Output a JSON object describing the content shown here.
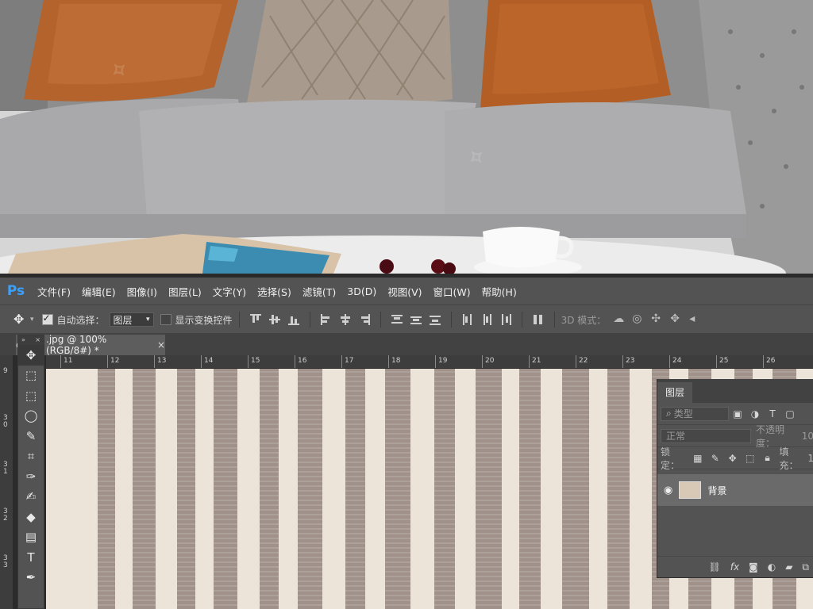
{
  "app": {
    "logo": "Ps"
  },
  "menu": [
    "文件(F)",
    "编辑(E)",
    "图像(I)",
    "图层(L)",
    "文字(Y)",
    "选择(S)",
    "滤镜(T)",
    "3D(D)",
    "视图(V)",
    "窗口(W)",
    "帮助(H)"
  ],
  "options": {
    "auto_select_label": "自动选择：",
    "auto_select_checked": true,
    "target_value": "图层",
    "show_transform_label": "显示变换控件",
    "show_transform_checked": false,
    "mode_3d_label": "3D 模式："
  },
  "document": {
    "tab_title": ".jpg @ 100%(RGB/8#) *",
    "tab_prefix": "c",
    "close_label": "×"
  },
  "ruler": {
    "h_ticks": [
      "11",
      "12",
      "13",
      "14",
      "15",
      "16",
      "17",
      "18",
      "19",
      "20",
      "21",
      "22",
      "23",
      "24",
      "25",
      "26"
    ],
    "v_ticks": [
      "9",
      "30",
      "31",
      "32",
      "33"
    ]
  },
  "tools": [
    {
      "name": "move-tool",
      "glyph": "✥"
    },
    {
      "name": "artboard-tool",
      "glyph": "⬚"
    },
    {
      "name": "marquee-tool",
      "glyph": "⬚"
    },
    {
      "name": "lasso-tool",
      "glyph": "◯"
    },
    {
      "name": "quick-select-tool",
      "glyph": "✎"
    },
    {
      "name": "crop-tool",
      "glyph": "⌗"
    },
    {
      "name": "eyedropper-tool",
      "glyph": "✑"
    },
    {
      "name": "brush-tool",
      "glyph": "✍"
    },
    {
      "name": "eraser-tool",
      "glyph": "◆"
    },
    {
      "name": "gradient-tool",
      "glyph": "▤"
    },
    {
      "name": "type-tool",
      "glyph": "T"
    },
    {
      "name": "pen-tool",
      "glyph": "✒"
    }
  ],
  "layers_panel": {
    "tab": "图层",
    "filter_kind": "类型",
    "blend_mode": "正常",
    "opacity_label": "不透明度：",
    "opacity_value": "10",
    "lock_label": "锁定：",
    "fill_label": "填充：",
    "fill_value": "1",
    "layers": [
      {
        "name": "背景",
        "visible": true
      }
    ],
    "footer_icons": [
      "link-icon",
      "fx-icon",
      "mask-icon",
      "adjustment-icon",
      "folder-icon",
      "new-layer-icon"
    ],
    "fx_label": "fx"
  },
  "colors": {
    "panel": "#535353",
    "logo": "#3aa0ff",
    "canvas_bg": "#ece4d8",
    "stripe": "#8b7b74"
  }
}
